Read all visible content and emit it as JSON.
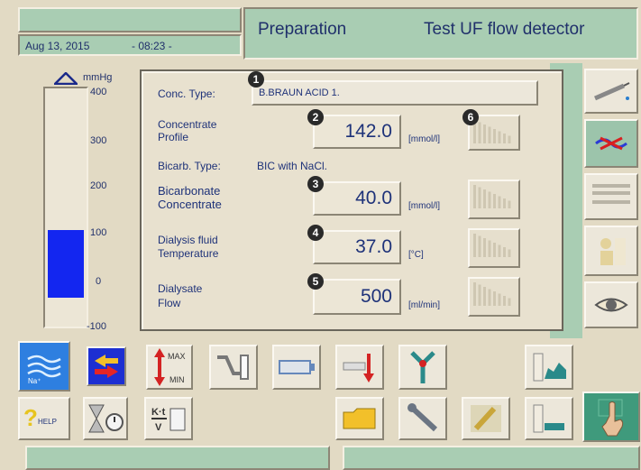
{
  "header": {
    "date": "Aug 13, 2015",
    "time": "- 08:23 -",
    "mode": "Preparation",
    "status": "Test UF flow detector"
  },
  "pressure": {
    "unit": "mmHg",
    "ticks": [
      "400",
      "300",
      "200",
      "100",
      "0",
      "-100"
    ],
    "level_value": 100
  },
  "panel": {
    "conc_type_label": "Conc. Type:",
    "conc_type_value": "B.BRAUN ACID 1.",
    "concentrate_label": [
      "Concentrate",
      "Profile"
    ],
    "concentrate_value": "142.0",
    "concentrate_unit": "[mmol/l]",
    "bicarb_type_label": "Bicarb. Type:",
    "bicarb_type_value": "BIC with NaCl.",
    "bicarbonate_label": [
      "Bicarbonate",
      "Concentrate"
    ],
    "bicarbonate_value": "40.0",
    "bicarbonate_unit": "[mmol/l]",
    "temp_label": [
      "Dialysis fluid",
      "Temperature"
    ],
    "temp_value": "37.0",
    "temp_unit": "[°C]",
    "flow_label": [
      "Dialysate",
      "Flow"
    ],
    "flow_value": "500",
    "flow_unit": "[ml/min]",
    "markers": [
      "1",
      "2",
      "3",
      "4",
      "5",
      "6"
    ]
  },
  "toolbar": {
    "max_label": "MAX",
    "min_label": "MIN",
    "na_label": "Na⁺",
    "help_label": "HELP",
    "kt_label": "K·t",
    "v_label": "V"
  },
  "icons": {
    "trend": "trend-graph-icon",
    "syringe": "syringe-icon",
    "dialyzer": "dialyzer-icon",
    "eye": "eye-icon"
  }
}
